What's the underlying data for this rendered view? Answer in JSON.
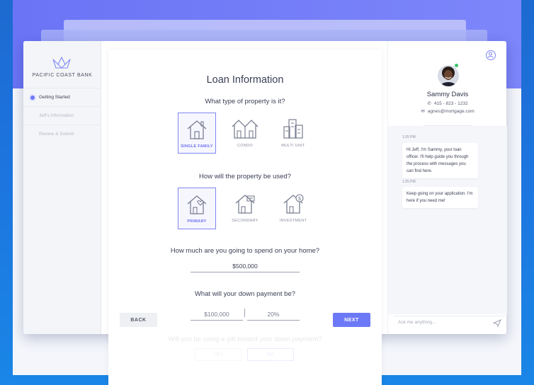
{
  "sidebar": {
    "bank_name": "PACIFIC COAST BANK",
    "items": [
      {
        "label": "Getting Started"
      },
      {
        "label": "Jeff's Information"
      },
      {
        "label": "Review & Submit"
      }
    ]
  },
  "form": {
    "title": "Loan Information",
    "q1": "What type of property is it?",
    "property_types": [
      {
        "label": "SINGLE FAMILY",
        "icon": "single-family-house-icon",
        "selected": true
      },
      {
        "label": "CONDO",
        "icon": "condo-icon",
        "selected": false
      },
      {
        "label": "MULTI UNIT",
        "icon": "multi-unit-building-icon",
        "selected": false
      }
    ],
    "q2": "How will the property be used?",
    "usage_types": [
      {
        "label": "PRIMARY",
        "icon": "house-heart-icon",
        "selected": true
      },
      {
        "label": "SECONDARY",
        "icon": "house-secondary-icon",
        "selected": false
      },
      {
        "label": "INVESTMENT",
        "icon": "house-dollar-icon",
        "selected": false
      }
    ],
    "q3": "How much are you going to spend on your home?",
    "home_price": "$500,000",
    "q4": "What will your down payment be?",
    "down_payment_amount": "$100,000",
    "down_payment_percent": "20%",
    "q5": "Will you be using a gift toward your down payment?",
    "yes_label": "YES",
    "no_label": "NO",
    "back_label": "BACK",
    "next_label": "NEXT"
  },
  "chat": {
    "agent_name": "Sammy Davis",
    "agent_phone": "415 - 823 - 1232",
    "agent_email": "agnes@mortgage.com",
    "messages": [
      {
        "time": "1:25 PM",
        "text": "Hi Jeff, I'm Sammy, your loan officer. I'll help guide you through the process with messages you can find here."
      },
      {
        "time": "1:25 PM",
        "text": "Keep going on your application. I'm here if you need me!"
      }
    ],
    "input_placeholder": "Ask me anything..."
  },
  "colors": {
    "accent": "#6c79f7",
    "background_blue": "#1d6ad0"
  }
}
